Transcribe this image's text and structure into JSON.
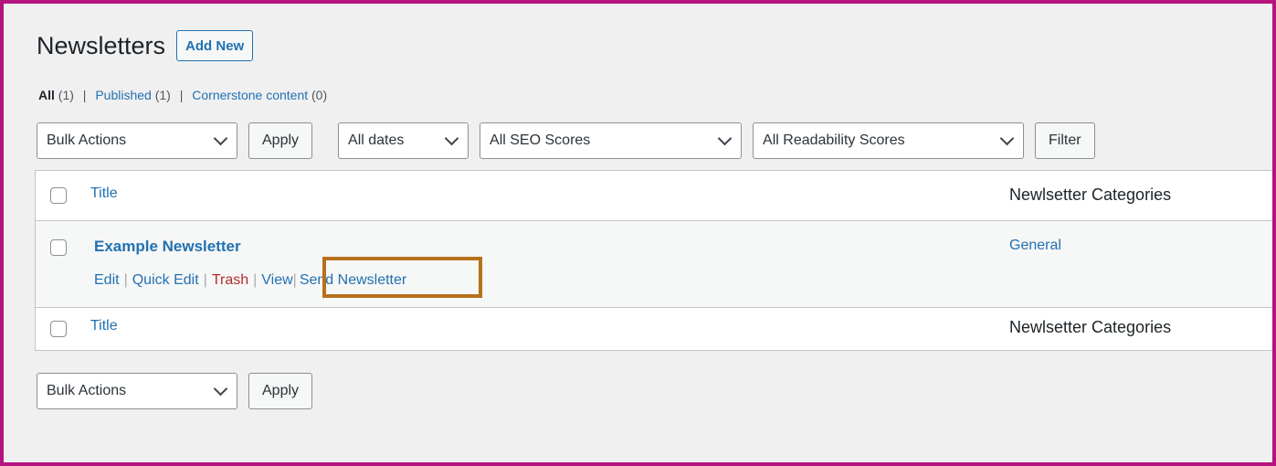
{
  "page": {
    "title": "Newsletters",
    "add_new_label": "Add New"
  },
  "views": {
    "all_label": "All",
    "all_count": "(1)",
    "published_label": "Published",
    "published_count": "(1)",
    "cornerstone_label": "Cornerstone content",
    "cornerstone_count": "(0)",
    "separator": "|"
  },
  "top_controls": {
    "bulk_actions": "Bulk Actions",
    "apply_label": "Apply",
    "dates": "All dates",
    "seo": "All SEO Scores",
    "readability": "All Readability Scores",
    "filter_label": "Filter"
  },
  "table": {
    "columns": {
      "title": "Title",
      "categories": "Newlsetter Categories"
    },
    "rows": [
      {
        "title": "Example Newsletter",
        "category": "General",
        "actions": {
          "edit": "Edit",
          "quick_edit": "Quick Edit",
          "trash": "Trash",
          "view": "View",
          "send": "Send Newsletter"
        }
      }
    ]
  },
  "bottom_controls": {
    "bulk_actions": "Bulk Actions",
    "apply_label": "Apply"
  },
  "colors": {
    "frame_border": "#b5137f",
    "highlight_border": "#b7701c",
    "link": "#2271b1",
    "trash": "#b32d2e"
  }
}
